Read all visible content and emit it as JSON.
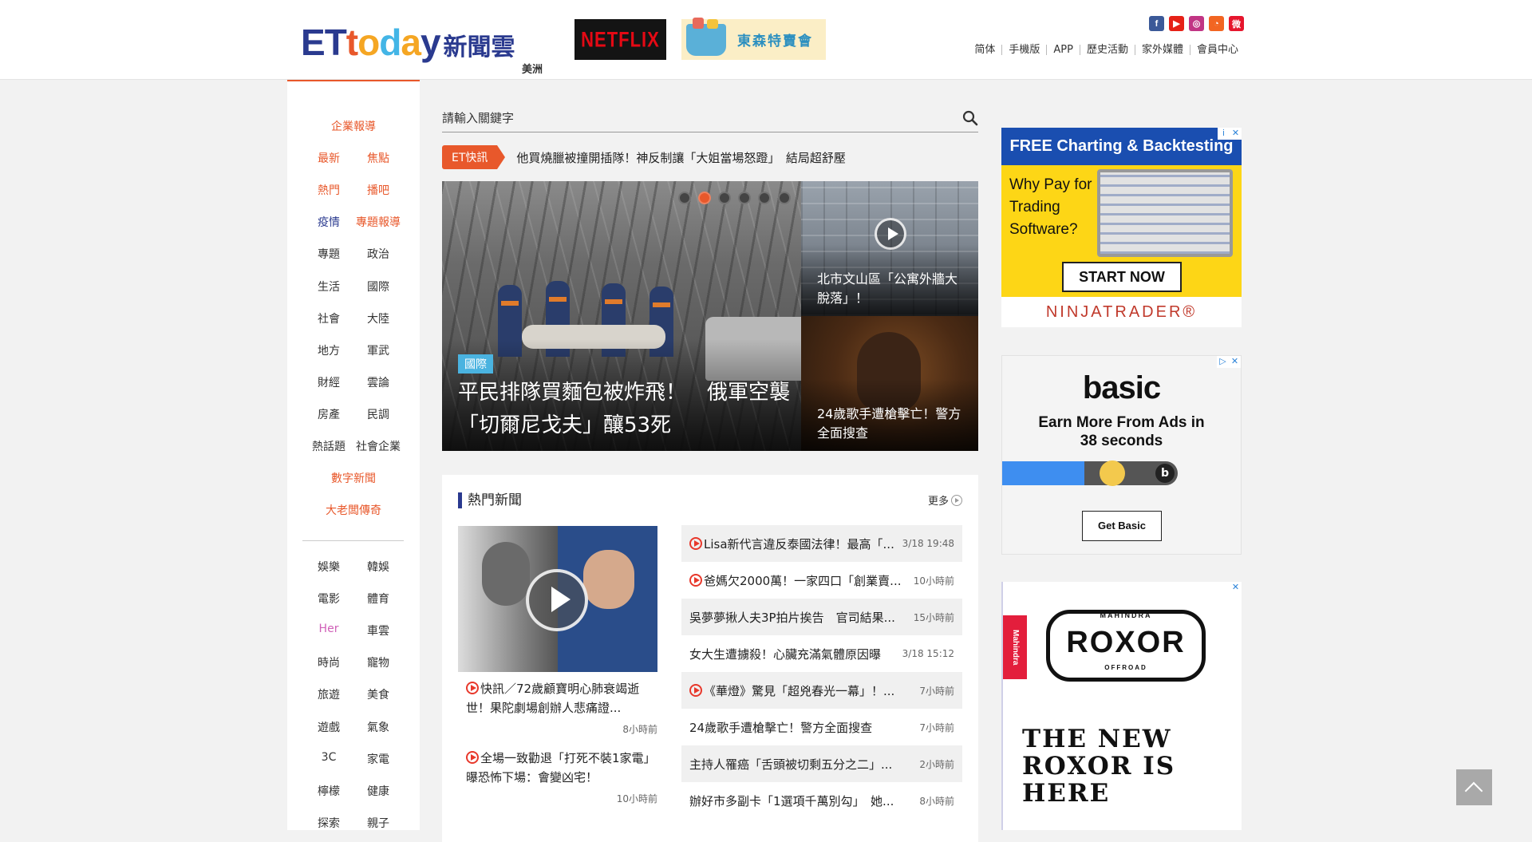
{
  "header": {
    "logo_et": [
      "E",
      "T",
      "t",
      "o",
      "d",
      "a",
      "y"
    ],
    "logo_cn": "新聞雲",
    "edition": "美洲",
    "netflix_ad": "NETFLIX",
    "tokyo_ad": "東森特賣會",
    "social_icons": [
      "facebook-icon",
      "youtube-icon",
      "instagram-icon",
      "rss-icon",
      "weibo-icon"
    ],
    "social_colors": [
      "#3b5998",
      "#e62117",
      "#c13584",
      "#f26522",
      "#e6162d"
    ],
    "toplinks": [
      "简体",
      "手機版",
      "APP",
      "歷史活動",
      "家外媒體",
      "會員中心"
    ]
  },
  "nav": {
    "group1": [
      [
        "企業報導"
      ],
      [
        "最新",
        "焦點"
      ],
      [
        "熱門",
        "播吧"
      ],
      [
        "疫情",
        "專題報導"
      ],
      [
        "專題",
        "政治"
      ],
      [
        "生活",
        "國際"
      ],
      [
        "社會",
        "大陸"
      ],
      [
        "地方",
        "軍武"
      ],
      [
        "財經",
        "雲論"
      ],
      [
        "房產",
        "民調"
      ],
      [
        "熱話題",
        "社會企業"
      ],
      [
        "數字新聞"
      ],
      [
        "大老闆傳奇"
      ]
    ],
    "group1_colors": [
      [
        "o"
      ],
      [
        "o",
        "o"
      ],
      [
        "o",
        "o"
      ],
      [
        "b",
        "o"
      ],
      [
        "",
        ""
      ],
      [
        "",
        ""
      ],
      [
        "",
        ""
      ],
      [
        "",
        ""
      ],
      [
        "",
        ""
      ],
      [
        "",
        ""
      ],
      [
        "",
        ""
      ],
      [
        "o"
      ],
      [
        "o"
      ]
    ],
    "group2": [
      [
        "娛樂",
        "韓娛"
      ],
      [
        "電影",
        "體育"
      ],
      [
        "Her",
        "車雲"
      ],
      [
        "時尚",
        "寵物"
      ],
      [
        "旅遊",
        "美食"
      ],
      [
        "遊戲",
        "氣象"
      ],
      [
        "3C",
        "家電"
      ],
      [
        "檸檬",
        "健康"
      ],
      [
        "探索",
        "親子"
      ]
    ],
    "group2_colors": [
      [
        "",
        ""
      ],
      [
        "",
        ""
      ],
      [
        "p",
        ""
      ],
      [
        "",
        ""
      ],
      [
        "",
        ""
      ],
      [
        "",
        ""
      ],
      [
        "",
        ""
      ],
      [
        "",
        ""
      ],
      [
        "",
        ""
      ]
    ]
  },
  "search": {
    "placeholder": "請輸入關鍵字"
  },
  "flash": {
    "tag": "ET快訊",
    "text": "他買燒臘被撞開插隊！神反制讓「大姐當場怒蹬」　結局超舒壓"
  },
  "hero": {
    "category": "國際",
    "headline": "平民排隊買麵包被炸飛！　俄軍空襲「切爾尼戈夫」釀53死",
    "slides": 6,
    "active_slide": 1,
    "side1": "北市文山區「公寓外牆大脫落」！",
    "side2": "24歲歌手遭槍擊亡！警方全面搜查"
  },
  "hot": {
    "title": "熱門新聞",
    "more": "更多",
    "video_items": [
      {
        "text": "快訊／72歲顧寶明心肺衰竭逝世！果陀劇場創辦人悲痛證...",
        "time": "8小時前"
      },
      {
        "text": "全場一致勸退「打死不裝1家電」　曝恐怖下場：會變凶宅！",
        "time": "10小時前"
      }
    ],
    "list": [
      {
        "text": "Lisa新代言違反泰國法律！最高「...",
        "time": "3/18 19:48",
        "video": true
      },
      {
        "text": "爸媽欠2000萬！一家四口「創業賣...",
        "time": "10小時前",
        "video": true
      },
      {
        "text": "吳夢夢揪人夫3P拍片挨告　官司結果...",
        "time": "15小時前",
        "video": false
      },
      {
        "text": "女大生遭擄殺！心臟充滿氣體原因曝",
        "time": "3/18 15:12",
        "video": false
      },
      {
        "text": "《華燈》驚見「超兇春光一幕」！...",
        "time": "7小時前",
        "video": true
      },
      {
        "text": "24歲歌手遭槍擊亡！警方全面搜查",
        "time": "7小時前",
        "video": false
      },
      {
        "text": "主持人罹癌「舌頭被切剩五分之二」...",
        "time": "2小時前",
        "video": false
      },
      {
        "text": "辦好市多副卡「1選項千萬別勾」　她...",
        "time": "8小時前",
        "video": false
      }
    ]
  },
  "ads": {
    "ninja": {
      "top": "FREE Charting & Backtesting",
      "q": [
        "Why Pay for",
        "Trading",
        "Software?"
      ],
      "btn": "START NOW",
      "foot": "NINJATRADER®"
    },
    "basic": {
      "logo": "basic",
      "msg": [
        "Earn More From Ads in",
        "38 seconds"
      ],
      "btn": "Get Basic",
      "progress": 0.47
    },
    "roxor": {
      "tab": "Mahindra",
      "mahi": "MAHINDRA",
      "name": "ROXOR",
      "off": "OFFROAD",
      "slogan": [
        "THE NEW",
        "ROXOR IS",
        "HERE"
      ]
    }
  }
}
